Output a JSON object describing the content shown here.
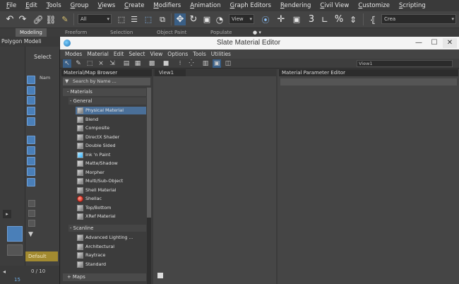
{
  "menubar": {
    "items": [
      "File",
      "Edit",
      "Tools",
      "Group",
      "Views",
      "Create",
      "Modifiers",
      "Animation",
      "Graph Editors",
      "Rendering",
      "Civil View",
      "Customize",
      "Scripting"
    ]
  },
  "toolbar": {
    "filter_value": "All",
    "view_value": "View",
    "snap_3": "3",
    "percent": "%",
    "create_partial": "Crea"
  },
  "ribbon": {
    "tabs": [
      "Modeling",
      "Freeform",
      "Selection",
      "Object Paint",
      "Populate"
    ]
  },
  "left": {
    "polygon_modeling": "Polygon Modeli",
    "select_label": "Select",
    "name_col": "Nam",
    "default_label": "Default",
    "frame_counter": "0 / 10",
    "frame_num": "15"
  },
  "slate": {
    "title": "Slate Material Editor",
    "menu": [
      "Modes",
      "Material",
      "Edit",
      "Select",
      "View",
      "Options",
      "Tools",
      "Utilities"
    ],
    "view_selector": "View1",
    "browser": {
      "header": "Material/Map Browser",
      "search_placeholder": "Search by Name ...",
      "groups": {
        "materials": "Materials",
        "general": "General",
        "scanline": "Scanline",
        "maps": "Maps"
      },
      "general_items": [
        "Physical Material",
        "Blend",
        "Composite",
        "DirectX Shader",
        "Double Sided",
        "Ink 'n Paint",
        "Matte/Shadow",
        "Morpher",
        "Multi/Sub-Object",
        "Shell Material",
        "Shellac",
        "Top/Bottom",
        "XRef Material"
      ],
      "scanline_items": [
        "Advanced Lighting ...",
        "Architectural",
        "Raytrace",
        "Standard"
      ]
    },
    "view_tab": "View1",
    "param_header": "Material Parameter Editor"
  },
  "colors": {
    "selection_blue": "#4a6f98",
    "highlight_gold": "#a28a30",
    "accent_blue": "#4a7fb8"
  }
}
